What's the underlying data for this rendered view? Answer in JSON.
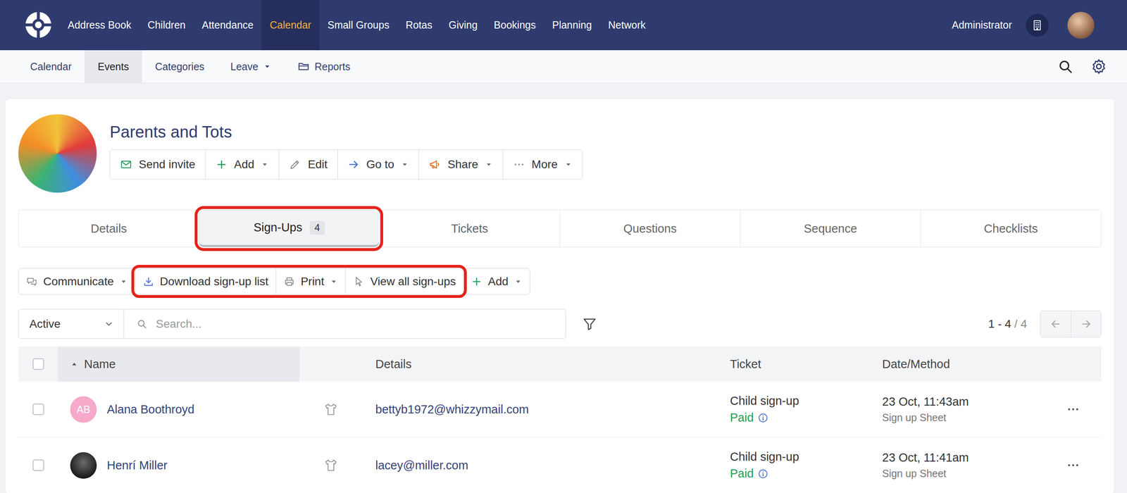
{
  "nav": {
    "items": [
      {
        "label": "Address Book",
        "selected": false
      },
      {
        "label": "Children",
        "selected": false
      },
      {
        "label": "Attendance",
        "selected": false
      },
      {
        "label": "Calendar",
        "selected": true
      },
      {
        "label": "Small Groups",
        "selected": false
      },
      {
        "label": "Rotas",
        "selected": false
      },
      {
        "label": "Giving",
        "selected": false
      },
      {
        "label": "Bookings",
        "selected": false
      },
      {
        "label": "Planning",
        "selected": false
      },
      {
        "label": "Network",
        "selected": false
      }
    ],
    "user": "Administrator"
  },
  "subnav": {
    "items": [
      {
        "label": "Calendar",
        "selected": false,
        "kind": "link"
      },
      {
        "label": "Events",
        "selected": true,
        "kind": "link"
      },
      {
        "label": "Categories",
        "selected": false,
        "kind": "link"
      },
      {
        "label": "Leave",
        "selected": false,
        "kind": "dropdown"
      },
      {
        "label": "Reports",
        "selected": false,
        "kind": "folder"
      }
    ]
  },
  "event": {
    "title": "Parents and Tots",
    "actions": [
      {
        "label": "Send invite",
        "dropdown": false
      },
      {
        "label": "Add",
        "dropdown": true
      },
      {
        "label": "Edit",
        "dropdown": false
      },
      {
        "label": "Go to",
        "dropdown": true
      },
      {
        "label": "Share",
        "dropdown": true
      },
      {
        "label": "More",
        "dropdown": true
      }
    ]
  },
  "tabs": [
    {
      "label": "Details",
      "selected": false,
      "highlighted": false
    },
    {
      "label": "Sign-Ups",
      "badge": "4",
      "selected": true,
      "highlighted": true
    },
    {
      "label": "Tickets",
      "selected": false,
      "highlighted": false
    },
    {
      "label": "Questions",
      "selected": false,
      "highlighted": false
    },
    {
      "label": "Sequence",
      "selected": false,
      "highlighted": false
    },
    {
      "label": "Checklists",
      "selected": false,
      "highlighted": false
    }
  ],
  "toolbar": [
    {
      "label": "Communicate",
      "dropdown": true,
      "highlighted": false
    },
    {
      "label": "Download sign-up list",
      "dropdown": false,
      "highlighted": true
    },
    {
      "label": "Print",
      "dropdown": true,
      "highlighted": true
    },
    {
      "label": "View all sign-ups",
      "dropdown": false,
      "highlighted": true
    },
    {
      "label": "Add",
      "dropdown": true,
      "highlighted": false
    }
  ],
  "filter": {
    "status": "Active",
    "search": {
      "placeholder": "Search..."
    },
    "range": "1 - 4",
    "total": "/ 4"
  },
  "table": {
    "columns": [
      {
        "label": "Name",
        "sorted": true
      },
      {
        "label": "Details",
        "sorted": false
      },
      {
        "label": "Ticket",
        "sorted": false
      },
      {
        "label": "Date/Method",
        "sorted": false
      }
    ],
    "rows": [
      {
        "checked": false,
        "avatar": {
          "kind": "initials",
          "text": "AB",
          "color": "#f6a9c9"
        },
        "name": "Alana Boothroyd",
        "details": "bettyb1972@whizzymail.com",
        "ticket": "Child sign-up",
        "payment": "Paid",
        "date": "23 Oct, 11:43am",
        "method": "Sign up Sheet"
      },
      {
        "checked": false,
        "avatar": {
          "kind": "photo"
        },
        "name": "Henrí Miller",
        "details": "lacey@miller.com",
        "ticket": "Child sign-up",
        "payment": "Paid",
        "date": "23 Oct, 11:41am",
        "method": "Sign up Sheet"
      }
    ]
  }
}
